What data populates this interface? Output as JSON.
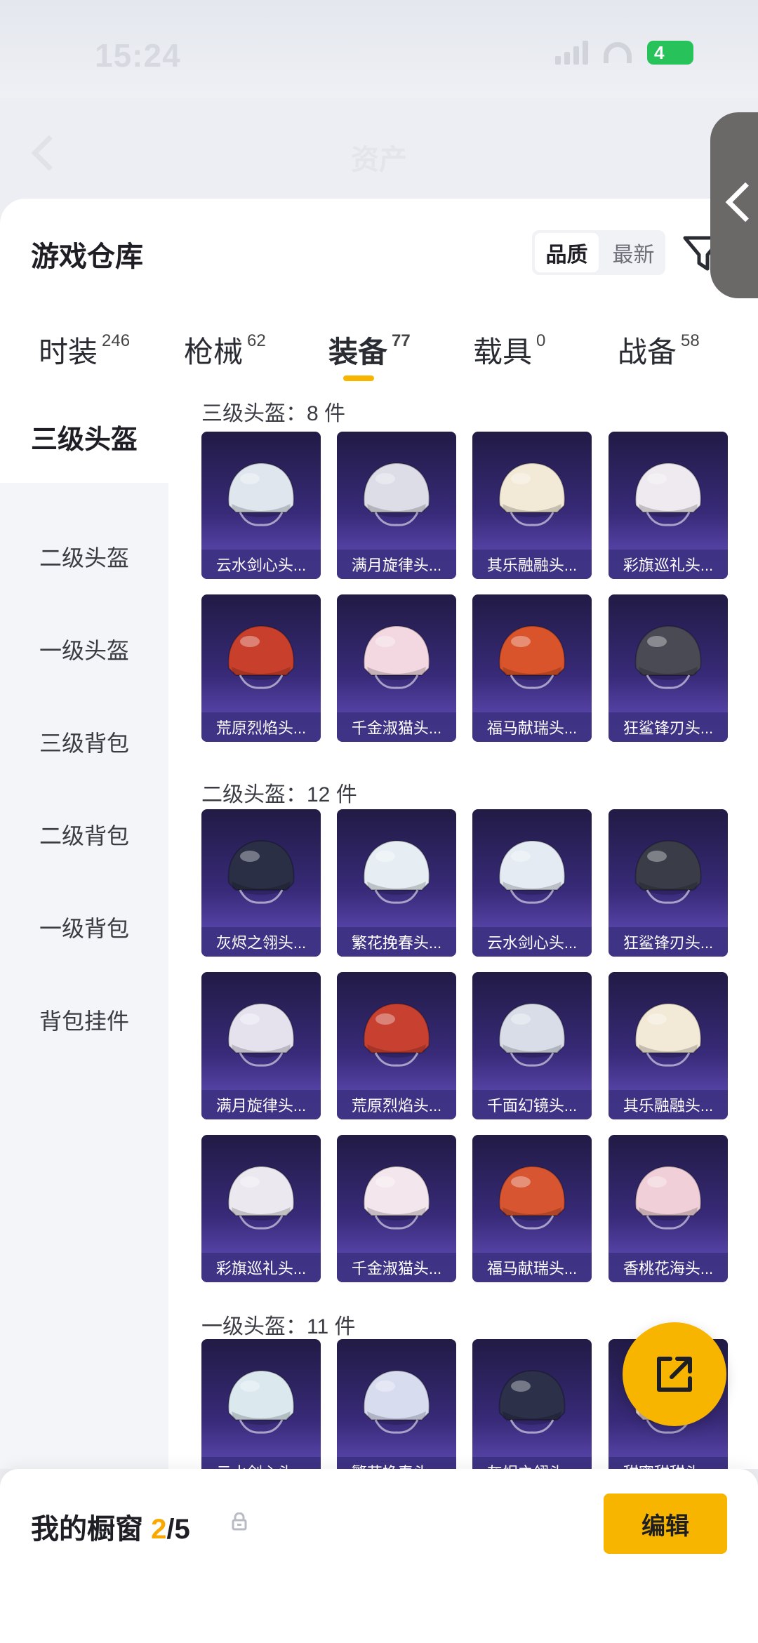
{
  "status": {
    "time": "15:24",
    "battery": "4"
  },
  "nav": {
    "title": "资产"
  },
  "panel": {
    "title": "游戏仓库"
  },
  "sort": {
    "options": [
      "品质",
      "最新"
    ],
    "active": "品质"
  },
  "tabs": [
    {
      "label": "时装",
      "count": "246"
    },
    {
      "label": "枪械",
      "count": "62"
    },
    {
      "label": "装备",
      "count": "77"
    },
    {
      "label": "载具",
      "count": "0"
    },
    {
      "label": "战备",
      "count": "58"
    }
  ],
  "categories": [
    "三级头盔",
    "二级头盔",
    "一级头盔",
    "三级背包",
    "二级背包",
    "一级背包",
    "背包挂件"
  ],
  "sections": [
    {
      "title": "三级头盔：8 件",
      "items": [
        "云水剑心头...",
        "满月旋律头...",
        "其乐融融头...",
        "彩旗巡礼头...",
        "荒原烈焰头...",
        "千金淑猫头...",
        "福马献瑞头...",
        "狂鲨锋刃头..."
      ]
    },
    {
      "title": "二级头盔：12 件",
      "items": [
        "灰烬之翎头...",
        "繁花挽春头...",
        "云水剑心头...",
        "狂鲨锋刃头...",
        "满月旋律头...",
        "荒原烈焰头...",
        "千面幻镜头...",
        "其乐融融头...",
        "彩旗巡礼头...",
        "千金淑猫头...",
        "福马献瑞头...",
        "香桃花海头..."
      ]
    },
    {
      "title": "一级头盔：11 件",
      "items": [
        "云水剑心头...",
        "繁花挽春头...",
        "灰烬之翎头...",
        "甜蜜甜甜头..."
      ]
    }
  ],
  "helmet_colors": {
    "s0": [
      "#dfe6ee",
      "#dcdde6",
      "#f2ead6",
      "#eeeaf0",
      "#c8402c",
      "#f3d8e2",
      "#d9542a",
      "#4a4a55"
    ],
    "s1": [
      "#2a2f45",
      "#e6eef3",
      "#e4ebf2",
      "#3a3c48",
      "#e5e2ee",
      "#c84030",
      "#d8dde8",
      "#f2ead6",
      "#ece8f0",
      "#f3e6ec",
      "#d75530",
      "#f0cfd8"
    ],
    "s2": [
      "#dbe8ee",
      "#d8dcef",
      "#2c3048",
      "#f2d8e0"
    ]
  },
  "bottom": {
    "label": "我的橱窗",
    "current": "2",
    "total": "/5",
    "edit": "编辑"
  }
}
